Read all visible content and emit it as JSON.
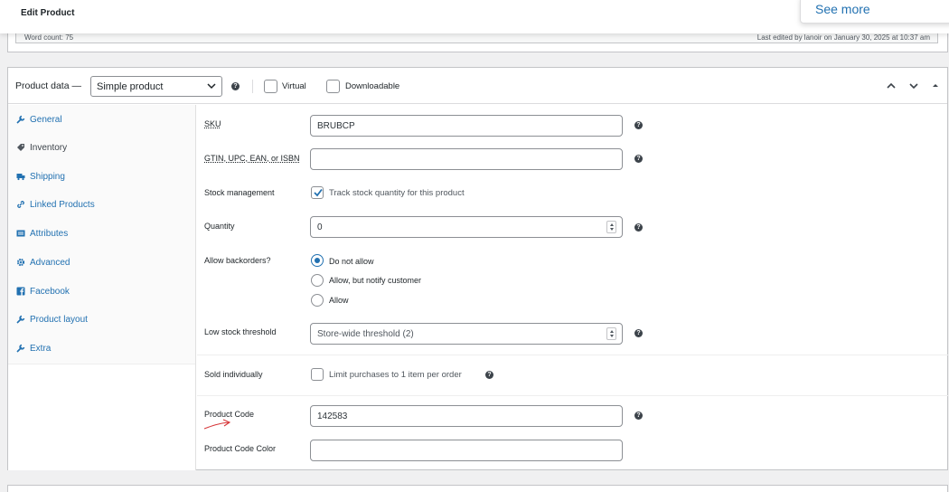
{
  "header": {
    "title": "Edit Product"
  },
  "popup": {
    "see_more": "See more"
  },
  "editor": {
    "word_count": "Word count: 75",
    "last_edited": "Last edited by lanoir on January 30, 2025 at 10:37 am"
  },
  "product_data": {
    "label": "Product data —",
    "type_value": "Simple product",
    "virtual_label": "Virtual",
    "downloadable_label": "Downloadable"
  },
  "tabs": [
    {
      "label": "General",
      "icon": "wrench-icon"
    },
    {
      "label": "Inventory",
      "icon": "tag-icon"
    },
    {
      "label": "Shipping",
      "icon": "truck-icon"
    },
    {
      "label": "Linked Products",
      "icon": "link-icon"
    },
    {
      "label": "Attributes",
      "icon": "list-icon"
    },
    {
      "label": "Advanced",
      "icon": "gear-icon"
    },
    {
      "label": "Facebook",
      "icon": "facebook-icon"
    },
    {
      "label": "Product layout",
      "icon": "wrench-icon"
    },
    {
      "label": "Extra",
      "icon": "wrench-icon"
    }
  ],
  "fields": {
    "sku": {
      "label": "SKU",
      "value": "BRUBCP"
    },
    "gtin": {
      "label": "GTIN, UPC, EAN, or ISBN",
      "value": ""
    },
    "stock_management": {
      "label": "Stock management",
      "checkbox_label": "Track stock quantity for this product",
      "checked": true
    },
    "quantity": {
      "label": "Quantity",
      "value": "0"
    },
    "backorders": {
      "label": "Allow backorders?",
      "options": [
        "Do not allow",
        "Allow, but notify customer",
        "Allow"
      ],
      "selected": "Do not allow"
    },
    "low_stock": {
      "label": "Low stock threshold",
      "placeholder": "Store-wide threshold (2)"
    },
    "sold_individually": {
      "label": "Sold individually",
      "checkbox_label": "Limit purchases to 1 item per order",
      "checked": false
    },
    "product_code": {
      "label": "Product Code",
      "value": "142583"
    },
    "product_code_color": {
      "label": "Product Code Color",
      "value": ""
    }
  },
  "colors": {
    "link": "#2271b1",
    "annotation": "#d63638"
  }
}
